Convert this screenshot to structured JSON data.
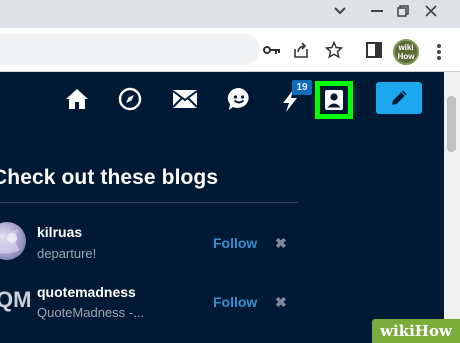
{
  "browser": {
    "icons": [
      "minimize-chevron-icon",
      "restore-window-icon",
      "close-window-icon",
      "key-icon",
      "share-icon",
      "bookmark-star-icon",
      "sidebar-icon",
      "profile-avatar",
      "kebab-menu-icon"
    ],
    "avatar_text": "wiki How"
  },
  "nav": {
    "notification_count": "19",
    "icons": [
      "home-icon",
      "explore-icon",
      "mail-icon",
      "chat-icon",
      "activity-icon",
      "account-icon",
      "compose-icon"
    ],
    "colors": {
      "account_highlight": "#00ff00",
      "compose_bg": "#1aa7ed",
      "badge_bg": "#0f6cb6"
    }
  },
  "section": {
    "title": "Check out these blogs"
  },
  "blogs": [
    {
      "name": "kilruas",
      "description": "departure!",
      "follow": "Follow",
      "dismiss": "✖"
    },
    {
      "name": "quotemadness",
      "description": "QuoteMadness -...",
      "avatar_text": "QM",
      "follow": "Follow",
      "dismiss": "✖"
    }
  ],
  "watermark": {
    "prefix": "wiki",
    "suffix": "How"
  }
}
